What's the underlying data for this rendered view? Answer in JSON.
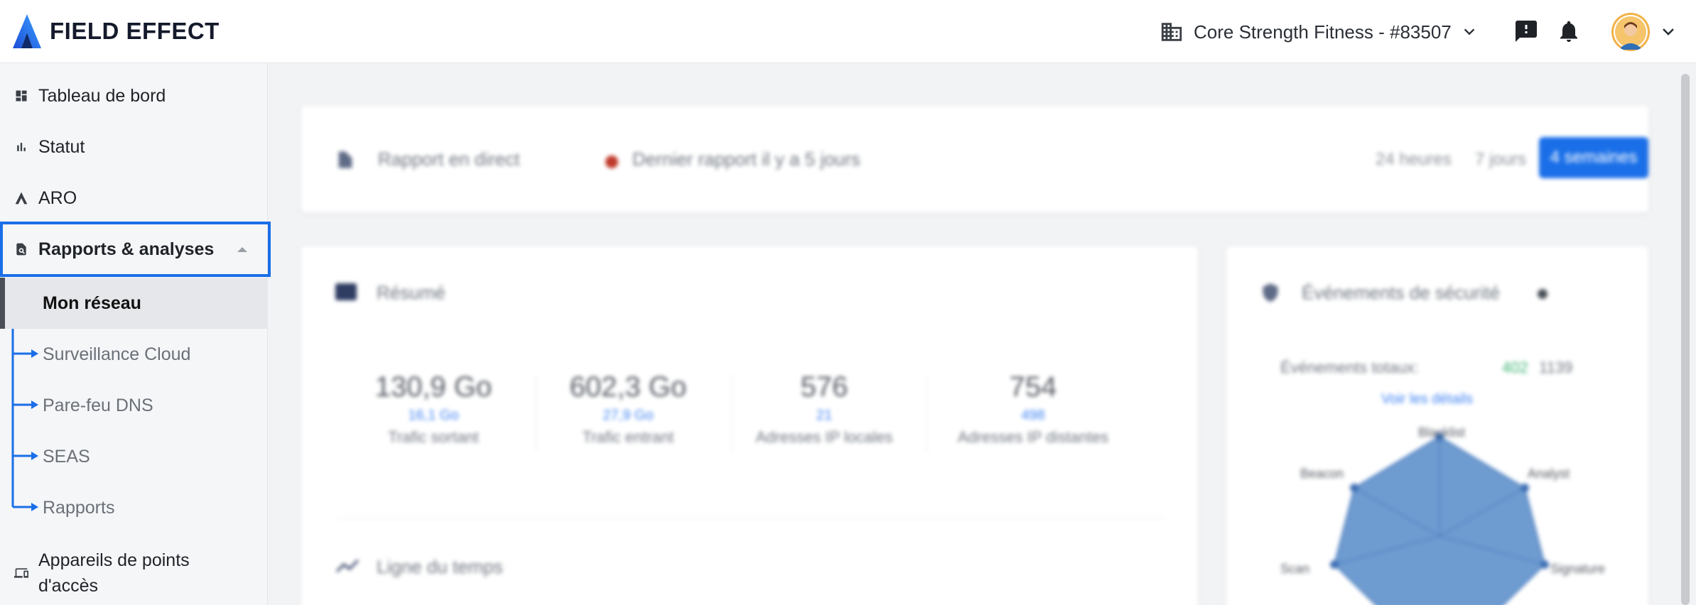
{
  "brand": {
    "name": "FIELD EFFECT"
  },
  "header": {
    "org_name": "Core Strength Fitness - #83507",
    "icons": [
      "building-icon",
      "chevron-down-icon",
      "feedback-icon",
      "bell-icon",
      "avatar",
      "chevron-down-icon"
    ]
  },
  "sidebar": {
    "items": [
      {
        "label": "Tableau de bord",
        "icon": "dashboard-icon"
      },
      {
        "label": "Statut",
        "icon": "bar-chart-icon"
      },
      {
        "label": "ARO",
        "icon": "aro-icon"
      },
      {
        "label": "Rapports & analyses",
        "icon": "report-search-icon"
      },
      {
        "label": "Appareils de points d'accès",
        "icon": "devices-icon"
      }
    ],
    "sub_items": [
      {
        "label": "Mon réseau"
      },
      {
        "label": "Surveillance Cloud"
      },
      {
        "label": "Pare-feu DNS"
      },
      {
        "label": "SEAS"
      },
      {
        "label": "Rapports"
      }
    ]
  },
  "main": {
    "report_bar": {
      "live_label": "Rapport en direct",
      "last_report": "Dernier rapport il y a 5 jours",
      "ranges": [
        "24 heures",
        "7 jours",
        "4 semaines"
      ],
      "selected_range": "4 semaines"
    },
    "summary": {
      "title": "Résumé",
      "stats": [
        {
          "value": "130,9 Go",
          "delta": "16,1 Go",
          "caption": "Trafic sortant"
        },
        {
          "value": "602,3 Go",
          "delta": "27,9 Go",
          "caption": "Trafic entrant"
        },
        {
          "value": "576",
          "delta": "21",
          "caption": "Adresses IP locales"
        },
        {
          "value": "754",
          "delta": "498",
          "caption": "Adresses IP distantes"
        }
      ],
      "timeline_title": "Ligne du temps"
    },
    "security": {
      "title": "Événements de sécurité",
      "total_label": "Événements totaux:",
      "total_delta": "402",
      "total_value": "1139",
      "details_link": "Voir les détails",
      "radar_axes": [
        "Blacklist",
        "Analyst",
        "Signature",
        "Beacon",
        "Scan"
      ]
    }
  },
  "colors": {
    "accent": "#1a6fe8",
    "radar_fill": "#6e9bd0",
    "status_dot": "#c0392b"
  }
}
